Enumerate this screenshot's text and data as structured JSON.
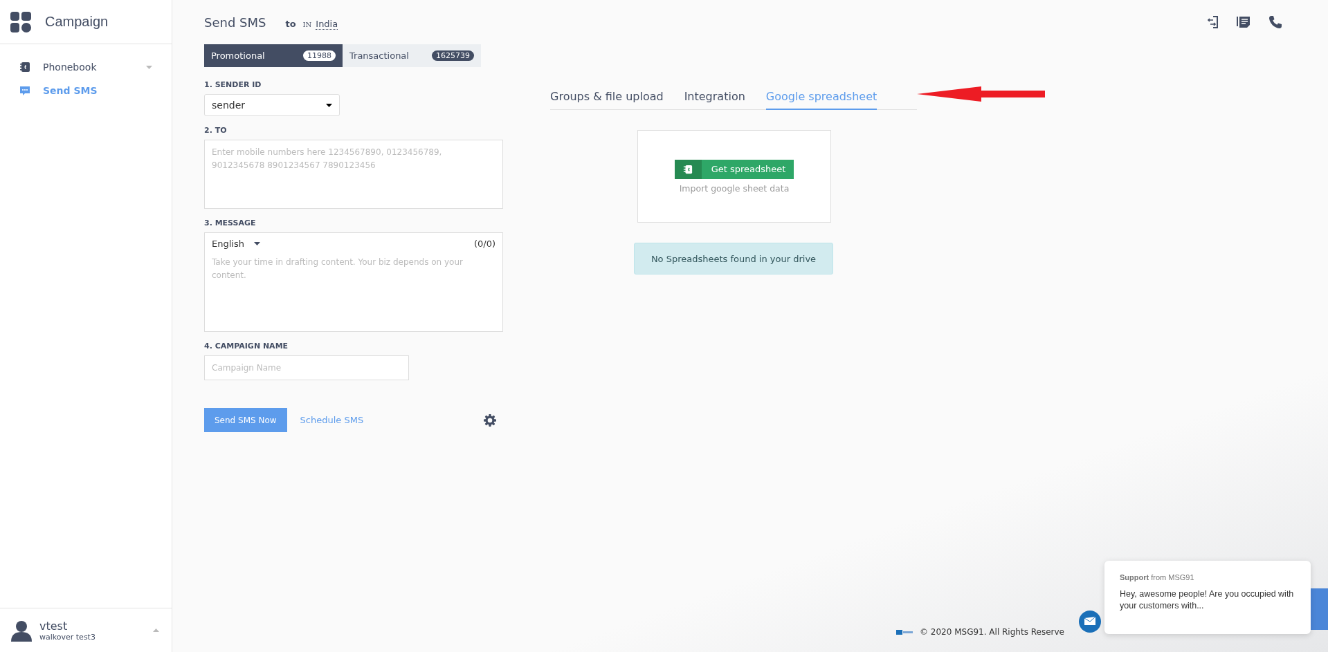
{
  "sidebar": {
    "title": "Campaign",
    "items": [
      {
        "label": "Phonebook",
        "kind": "group",
        "selected": false
      },
      {
        "label": "Send SMS",
        "kind": "link",
        "selected": true
      }
    ],
    "user": {
      "name": "vtest",
      "company": "walkover test3"
    }
  },
  "header": {
    "title": "Send SMS",
    "to_label": "to",
    "country_code": "IN",
    "country": "India"
  },
  "route_tabs": [
    {
      "label": "Promotional",
      "count": "11988",
      "selected": true
    },
    {
      "label": "Transactional",
      "count": "1625739",
      "selected": false
    }
  ],
  "form": {
    "sender_label": "1. SENDER ID",
    "sender_value": "sender",
    "to_label": "2. TO",
    "to_placeholder": "Enter mobile numbers here 1234567890, 0123456789, 9012345678 8901234567 7890123456",
    "message_label": "3. MESSAGE",
    "language": "English",
    "char_count": "(0/0)",
    "message_placeholder": "Take your time in drafting content. Your biz depends on your content.",
    "campaign_label": "4. CAMPAIGN NAME",
    "campaign_placeholder": "Campaign Name",
    "send_button": "Send SMS Now",
    "schedule_link": "Schedule SMS"
  },
  "source_tabs": [
    {
      "label": "Groups & file upload",
      "selected": false
    },
    {
      "label": "Integration",
      "selected": false
    },
    {
      "label": "Google spreadsheet",
      "selected": true
    }
  ],
  "spreadsheet": {
    "button": "Get spreadsheet",
    "hint": "Import google sheet data",
    "alert": "No Spreadsheets found in your drive"
  },
  "footer": {
    "copyright": "© 2020 MSG91. All Rights Reserve"
  },
  "chat": {
    "sender": "**Support** from MSG91",
    "message": "Hey, awesome people! Are you occupied with your customers with..."
  }
}
